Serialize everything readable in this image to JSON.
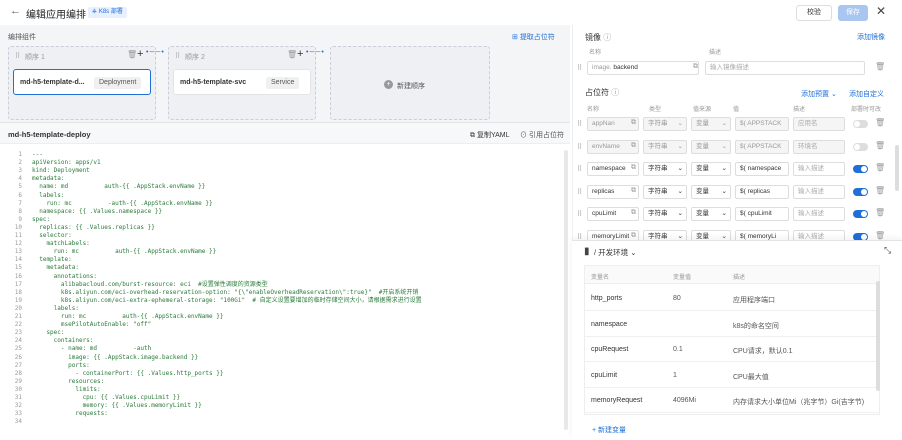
{
  "topbar": {
    "back_icon": "arrow-left",
    "title": "编辑应用编排",
    "badge": "K8s 部署",
    "verify": "校验",
    "save": "保存",
    "close_icon": "close"
  },
  "orchestration": {
    "label": "编排组件",
    "extract_link": "提取占位符",
    "steps": [
      {
        "label": "顺序 1",
        "name": "md-h5-template-d...",
        "type": "Deployment"
      },
      {
        "label": "顺序 2",
        "name": "md-h5-template-svc",
        "type": "Service"
      }
    ],
    "new_step": "新建顺序"
  },
  "editor": {
    "title": "md-h5-template-deploy",
    "copy_yaml": "复制YAML",
    "cite": "引用占位符",
    "line_numbers": [
      "1",
      "2",
      "3",
      "4",
      "5",
      "6",
      "7",
      "8",
      "9",
      "10",
      "11",
      "12",
      "13",
      "14",
      "15",
      "16",
      "17",
      "18",
      "19",
      "20",
      "21",
      "22",
      "23",
      "24",
      "25",
      "26",
      "27",
      "28",
      "29",
      "30",
      "31",
      "32",
      "33",
      "34"
    ],
    "lines": [
      "---",
      "apiVersion: apps/v1",
      "kind: Deployment",
      "metadata:",
      "  name: md          auth-{{ .AppStack.envName }}",
      "  labels:",
      "    run: mc          -auth-{{ .AppStack.envName }}",
      "  namespace: {{ .Values.namespace }}",
      "spec:",
      "  replicas: {{ .Values.replicas }}",
      "  selector:",
      "    matchLabels:",
      "      run: mc          auth-{{ .AppStack.envName }}",
      "  template:",
      "    metadata:",
      "      annotations:",
      "        alibabacloud.com/burst-resource: eci  #设置弹性调度的资源类型",
      "        k8s.aliyun.com/eci-overhead-reservation-option: \"{\\\"enableOverheadReservation\\\":true}\"  #开启系统开销",
      "        k8s.aliyun.com/eci-extra-ephemeral-storage: \"100Gi\"  # 自定义设置要增加的临时存储空间大小，请根据需求进行设置",
      "      labels:",
      "        run: mc          auth-{{ .AppStack.envName }}",
      "        msePilotAutoEnable: \"off\"",
      "    spec:",
      "      containers:",
      "        - name: md          -auth",
      "          image: {{ .AppStack.image.backend }}",
      "          ports:",
      "            - containerPort: {{ .Values.http_ports }}",
      "          resources:",
      "            limits:",
      "              cpu: {{ .Values.cpuLimit }}",
      "              memory: {{ .Values.memoryLimit }}",
      "            requests:",
      ""
    ]
  },
  "images": {
    "title": "镜像",
    "add": "添加镜像",
    "col_name": "名称",
    "col_desc": "描述",
    "name_prefix": "image.",
    "name_value": "backend",
    "desc_placeholder": "输入镜像描述"
  },
  "placeholders": {
    "title": "占位符",
    "add_preset": "添加预置",
    "add_custom": "添加自定义",
    "cols": [
      "名称",
      "类型",
      "值来源",
      "值",
      "描述",
      "部署时可改"
    ],
    "rows": [
      {
        "name": "appNan",
        "type": "字符串",
        "source": "变量",
        "value": "APPSTACK",
        "desc": "应用名",
        "editable": false,
        "disabled": true
      },
      {
        "name": "envName",
        "type": "字符串",
        "source": "变量",
        "value": "APPSTACK",
        "desc": "环境名",
        "editable": false,
        "disabled": true
      },
      {
        "name": "namespace",
        "type": "字符串",
        "source": "变量",
        "value": "namespace",
        "desc": "输入描述",
        "editable": true,
        "disabled": false
      },
      {
        "name": "replicas",
        "type": "字符串",
        "source": "变量",
        "value": "replicas",
        "desc": "输入描述",
        "editable": true,
        "disabled": false
      },
      {
        "name": "cpuLimit",
        "type": "字符串",
        "source": "变量",
        "value": "cpuLimit",
        "desc": "输入描述",
        "editable": true,
        "disabled": false
      },
      {
        "name": "memoryLimit",
        "type": "字符串",
        "source": "变量",
        "value": "memoryLi",
        "desc": "输入描述",
        "editable": true,
        "disabled": false
      }
    ]
  },
  "env": {
    "title": "/ 开发环境",
    "cols": [
      "变量名",
      "变量值",
      "描述"
    ],
    "rows": [
      {
        "name": "http_ports",
        "value": "80",
        "desc": "应用程序端口"
      },
      {
        "name": "namespace",
        "value": "",
        "desc": "k8s的命名空间"
      },
      {
        "name": "cpuRequest",
        "value": "0.1",
        "desc": "CPU请求，默认0.1"
      },
      {
        "name": "cpuLimit",
        "value": "1",
        "desc": "CPU最大值"
      },
      {
        "name": "memoryRequest",
        "value": "4096Mi",
        "desc": "内存请求大小单位Mi（兆字节）Gi(吉字节)"
      }
    ],
    "new_var": "新建变量"
  },
  "colors": {
    "accent": "#1f6fd6",
    "panel_bg": "#f4f5f7"
  }
}
